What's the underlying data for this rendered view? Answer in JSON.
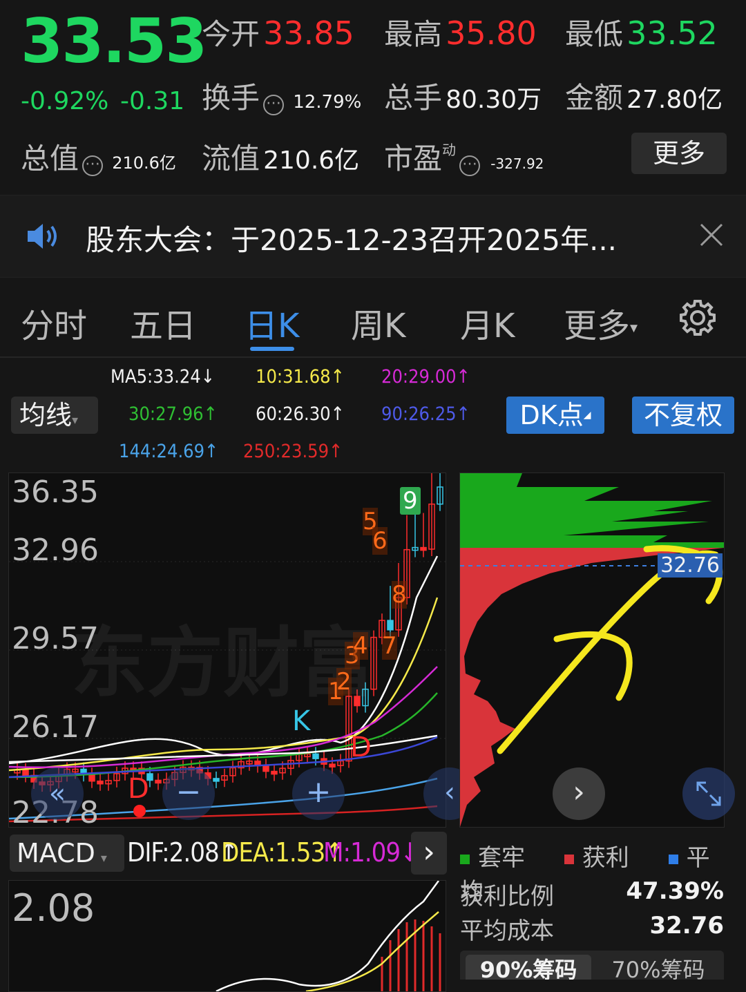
{
  "quote": {
    "price": "33.53",
    "change_pct": "-0.92%",
    "change": "-0.31",
    "open_label": "今开",
    "open_value": "33.85",
    "high_label": "最高",
    "high_value": "35.80",
    "low_label": "最低",
    "low_value": "33.52",
    "turnover_label": "换手",
    "turnover_value": "12.79%",
    "volume_label": "总手",
    "volume_value": "80.30万",
    "amount_label": "金额",
    "amount_value": "27.80亿",
    "mktcap_label": "总值",
    "mktcap_value": "210.6亿",
    "float_label": "流值",
    "float_value": "210.6亿",
    "pe_label": "市盈",
    "pe_sup": "动",
    "pe_value": "-327.92",
    "more_label": "更多"
  },
  "notice": {
    "text": "股东大会：于2025-12-23召开2025年..."
  },
  "tabs": [
    {
      "label": "分时"
    },
    {
      "label": "五日"
    },
    {
      "label": "日K"
    },
    {
      "label": "周K"
    },
    {
      "label": "月K"
    },
    {
      "label": "更多"
    }
  ],
  "ma": {
    "selector": "均线",
    "ma5": "MA5:33.24↓",
    "ma10": "10:31.68↑",
    "ma20": "20:29.00↑",
    "ma30": "30:27.96↑",
    "ma60": "60:26.30↑",
    "ma90": "90:26.25↑",
    "ma144": "144:24.69↑",
    "ma250": "250:23.59↑",
    "dk_button": "DK点",
    "fq_button": "不复权"
  },
  "kline": {
    "y_labels": [
      "36.35",
      "32.96",
      "29.57",
      "26.17",
      "22.78"
    ],
    "watermark": "东方财富",
    "signals": [
      "1",
      "2",
      "3",
      "4",
      "5",
      "6",
      "7",
      "8",
      "9"
    ],
    "markers": [
      "K",
      "D",
      "D"
    ]
  },
  "chips": {
    "avg_label": "32.76"
  },
  "macd": {
    "selector": "MACD",
    "dif": "DIF:2.08↑",
    "dea": "DEA:1.53↑",
    "m": "M:1.09↓",
    "y_label": "2.08"
  },
  "chip_stats": {
    "legend_trapped": "套牢",
    "legend_profit": "获利",
    "legend_avg": "平均",
    "profit_ratio_label": "获利比例",
    "profit_ratio_value": "47.39%",
    "avg_cost_label": "平均成本",
    "avg_cost_value": "32.76",
    "tab_90": "90%筹码",
    "tab_70": "70%筹码"
  },
  "colors": {
    "up": "#ff2d2d",
    "down": "#1ed760",
    "accent": "#2a73c9",
    "ma10": "#f5e94a",
    "ma20": "#d62ad6",
    "ma30": "#27b52a",
    "ma60": "#ffffff",
    "ma90": "#3b47d6",
    "ma144": "#4aa3e8",
    "ma250": "#d62222"
  }
}
